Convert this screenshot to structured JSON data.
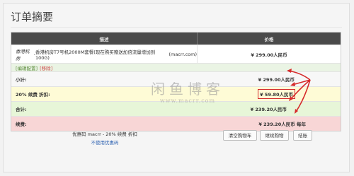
{
  "page": {
    "title": "订单摘要"
  },
  "table": {
    "headers": {
      "description": "描述",
      "price": "价格"
    },
    "product": {
      "group": "香港机房",
      "separator": " - ",
      "name": "香港机房T7号机2000M套餐(现在购买赠送加倍流量增加到100G)",
      "domain": "(macrr.com)",
      "price": "¥ 299.00人民币"
    },
    "links": {
      "edit": "[编辑配置]",
      "remove": "[移除]"
    },
    "rows": {
      "subtotal": {
        "label": "小计:",
        "value": "¥ 299.00人民币"
      },
      "promo": {
        "label": "20% 续费 折扣:",
        "value": "¥ 59.80人民币"
      },
      "total": {
        "label": "合计:",
        "value": "¥ 239.20人民币"
      },
      "recurring": {
        "label": "续费:",
        "value": "¥ 239.20人民币 每年"
      }
    }
  },
  "promo_code": {
    "line": "优惠码 macrr - 20% 续费 折扣",
    "remove_link": "不使用优惠码"
  },
  "buttons": {
    "empty_cart": "清空购物车",
    "continue_shopping": "继续购物",
    "checkout": "结账"
  },
  "watermark": {
    "title": "闲鱼博客",
    "url": "www.macrr.com"
  },
  "colors": {
    "annotation": "#d62b2b",
    "header_bg": "#4a4a4a"
  }
}
